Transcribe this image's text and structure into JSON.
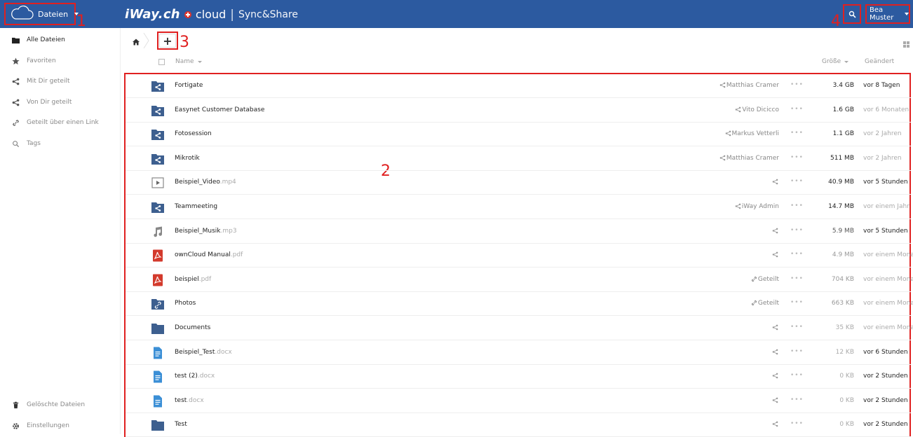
{
  "header": {
    "app_label": "Dateien",
    "brand_logo": "iWay.ch",
    "brand_cloud": "cloud",
    "brand_sep": "|",
    "brand_sub": "Sync&Share",
    "user_name": "Bea Muster",
    "bg_color": "#2c5aa0",
    "icons": [
      "cloud-icon",
      "search-icon"
    ]
  },
  "annotations": {
    "n1": "1",
    "n2": "2",
    "n3": "3",
    "n4": "4",
    "color": "#e02020"
  },
  "sidebar": {
    "items": [
      {
        "label": "Alle Dateien",
        "icon": "folder-icon",
        "active": true
      },
      {
        "label": "Favoriten",
        "icon": "star-icon"
      },
      {
        "label": "Mit Dir geteilt",
        "icon": "share-icon"
      },
      {
        "label": "Von Dir geteilt",
        "icon": "share-icon"
      },
      {
        "label": "Geteilt über einen Link",
        "icon": "link-icon"
      },
      {
        "label": "Tags",
        "icon": "tag-search-icon"
      }
    ],
    "bottom": [
      {
        "label": "Gelöschte Dateien",
        "icon": "trash-icon"
      },
      {
        "label": "Einstellungen",
        "icon": "gear-icon"
      }
    ]
  },
  "toolbar": {
    "new_label": "+"
  },
  "columns": {
    "name": "Name",
    "size": "Größe",
    "modified": "Geändert"
  },
  "files": [
    {
      "name": "Fortigate",
      "ext": "",
      "type": "shared-folder",
      "share": "Matthias Cramer",
      "share_type": "share",
      "size": "3.4 GB",
      "modified": "vor 8 Tagen",
      "size_color": "#222",
      "mod_color": "#222"
    },
    {
      "name": "Easynet Customer Database",
      "ext": "",
      "type": "shared-folder",
      "share": "Vito Dicicco",
      "share_type": "share",
      "size": "1.6 GB",
      "modified": "vor 6 Monaten",
      "size_color": "#222",
      "mod_color": "#aaa"
    },
    {
      "name": "Fotosession",
      "ext": "",
      "type": "shared-folder",
      "share": "Markus Vetterli",
      "share_type": "share",
      "size": "1.1 GB",
      "modified": "vor 2 Jahren",
      "size_color": "#222",
      "mod_color": "#aaa"
    },
    {
      "name": "Mikrotik",
      "ext": "",
      "type": "shared-folder",
      "share": "Matthias Cramer",
      "share_type": "share",
      "size": "511 MB",
      "modified": "vor 2 Jahren",
      "size_color": "#222",
      "mod_color": "#aaa"
    },
    {
      "name": "Beispiel_Video",
      "ext": ".mp4",
      "type": "video",
      "share": "",
      "share_type": "share",
      "size": "40.9 MB",
      "modified": "vor 5 Stunden",
      "size_color": "#222",
      "mod_color": "#222"
    },
    {
      "name": "Teammeeting",
      "ext": "",
      "type": "shared-folder",
      "share": "iWay Admin",
      "share_type": "share",
      "size": "14.7 MB",
      "modified": "vor einem Jahr",
      "size_color": "#222",
      "mod_color": "#aaa"
    },
    {
      "name": "Beispiel_Musik",
      "ext": ".mp3",
      "type": "audio",
      "share": "",
      "share_type": "share",
      "size": "5.9 MB",
      "modified": "vor 5 Stunden",
      "size_color": "#555",
      "mod_color": "#222"
    },
    {
      "name": "ownCloud Manual",
      "ext": ".pdf",
      "type": "pdf",
      "share": "",
      "share_type": "share",
      "size": "4.9 MB",
      "modified": "vor einem Monat",
      "size_color": "#999",
      "mod_color": "#aaa"
    },
    {
      "name": "beispiel",
      "ext": ".pdf",
      "type": "pdf",
      "share": "Geteilt",
      "share_type": "link",
      "size": "704 KB",
      "modified": "vor einem Monat",
      "size_color": "#999",
      "mod_color": "#aaa"
    },
    {
      "name": "Photos",
      "ext": "",
      "type": "link-folder",
      "share": "Geteilt",
      "share_type": "link",
      "size": "663 KB",
      "modified": "vor einem Monat",
      "size_color": "#999",
      "mod_color": "#aaa"
    },
    {
      "name": "Documents",
      "ext": "",
      "type": "folder",
      "share": "",
      "share_type": "share",
      "size": "35 KB",
      "modified": "vor einem Monat",
      "size_color": "#aaa",
      "mod_color": "#aaa"
    },
    {
      "name": "Beispiel_Test",
      "ext": ".docx",
      "type": "doc",
      "share": "",
      "share_type": "share",
      "size": "12 KB",
      "modified": "vor 6 Stunden",
      "size_color": "#aaa",
      "mod_color": "#222"
    },
    {
      "name": "test (2)",
      "ext": ".docx",
      "type": "doc",
      "share": "",
      "share_type": "share",
      "size": "0 KB",
      "modified": "vor 2 Stunden",
      "size_color": "#aaa",
      "mod_color": "#222"
    },
    {
      "name": "test",
      "ext": ".docx",
      "type": "doc",
      "share": "",
      "share_type": "share",
      "size": "0 KB",
      "modified": "vor 2 Stunden",
      "size_color": "#aaa",
      "mod_color": "#222"
    },
    {
      "name": "Test",
      "ext": "",
      "type": "folder",
      "share": "",
      "share_type": "share",
      "size": "0 KB",
      "modified": "vor 2 Stunden",
      "size_color": "#aaa",
      "mod_color": "#222"
    }
  ],
  "more_label": "•••"
}
